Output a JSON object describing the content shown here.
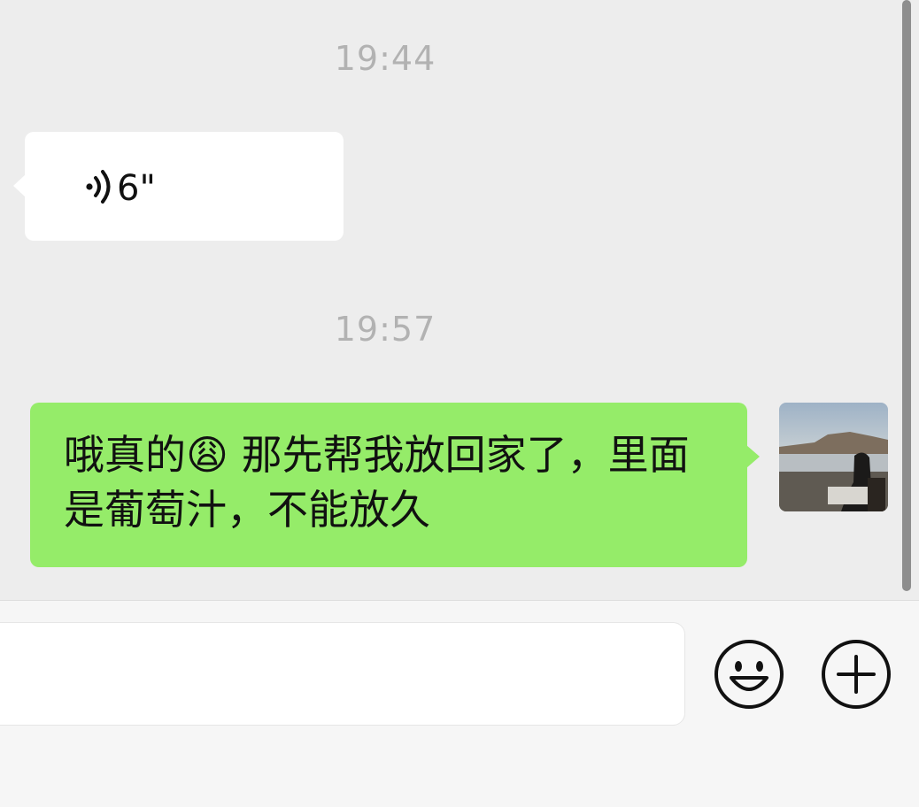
{
  "chat": {
    "timestamps": [
      "19:44",
      "19:57"
    ],
    "voice_message": {
      "duration": "6\""
    },
    "text_message": {
      "text": "哦真的😩 那先帮我放回家了，里面是葡萄汁，不能放久"
    }
  },
  "colors": {
    "background": "#ededed",
    "sent_bubble": "#95ec69",
    "received_bubble": "#ffffff",
    "timestamp": "#b2b2b2"
  },
  "icons": {
    "voice": "voice-wave-icon",
    "emoji": "smiley-face-icon",
    "more": "plus-circle-icon"
  }
}
